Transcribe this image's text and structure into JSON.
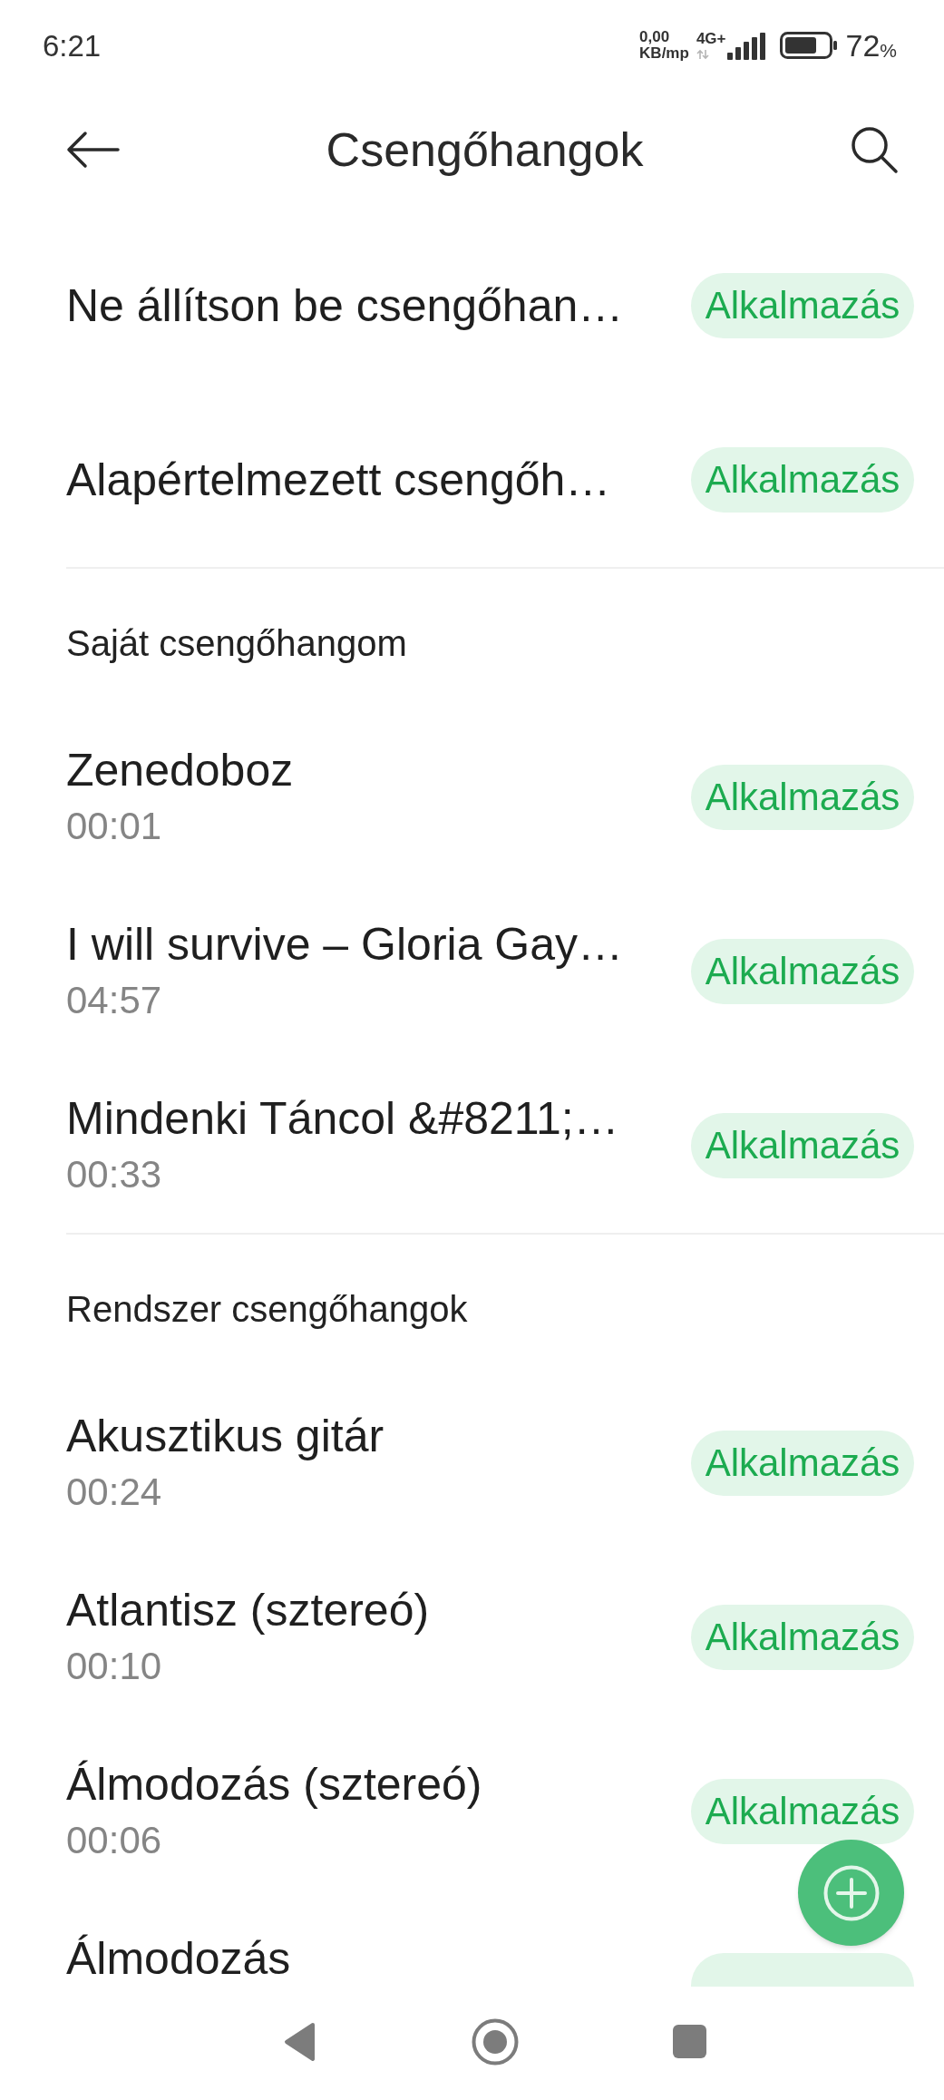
{
  "status_bar": {
    "time": "6:21",
    "speed_value": "0,00",
    "speed_unit": "KB/mp",
    "network": "4G+",
    "battery": "72",
    "battery_unit": "%"
  },
  "header": {
    "title": "Csengőhangok"
  },
  "top_options": [
    {
      "title": "Ne állítson be csengőhan…",
      "button": "Alkalmazás"
    },
    {
      "title": "Alapértelmezett csengőh…",
      "button": "Alkalmazás"
    }
  ],
  "sections": [
    {
      "heading": "Saját csengőhangom",
      "items": [
        {
          "title": "Zenedoboz",
          "duration": "00:01",
          "button": "Alkalmazás"
        },
        {
          "title": "I will survive – Gloria Gay…",
          "duration": "04:57",
          "button": "Alkalmazás"
        },
        {
          "title": "Mindenki Táncol &#8211;…",
          "duration": "00:33",
          "button": "Alkalmazás"
        }
      ]
    },
    {
      "heading": "Rendszer csengőhangok",
      "items": [
        {
          "title": "Akusztikus gitár",
          "duration": "00:24",
          "button": "Alkalmazás"
        },
        {
          "title": "Atlantisz (sztereó)",
          "duration": "00:10",
          "button": "Alkalmazás"
        },
        {
          "title": "Álmodozás (sztereó)",
          "duration": "00:06",
          "button": "Alkalmazás"
        },
        {
          "title": "Álmodozás"
        }
      ]
    }
  ]
}
